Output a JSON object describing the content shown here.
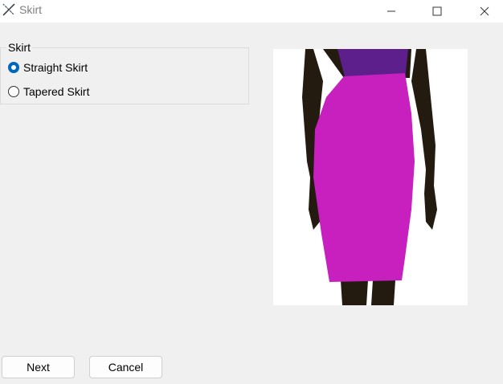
{
  "window": {
    "title": "Skirt",
    "icon": "pen-ruler-icon",
    "controls": [
      "minimize-icon",
      "maximize-icon",
      "close-icon"
    ]
  },
  "group": {
    "legend": "Skirt",
    "options": [
      {
        "label": "Straight Skirt",
        "checked": true
      },
      {
        "label": "Tapered Skirt",
        "checked": false
      }
    ]
  },
  "preview": {
    "image": "straight-skirt-illustration",
    "colors": {
      "skirt": "#c81fbf",
      "top": "#5c1f8c",
      "skin": "#231a10"
    }
  },
  "buttons": {
    "next": "Next",
    "cancel": "Cancel"
  },
  "colors": {
    "accent": "#0067c0",
    "background": "#f0f0f0"
  }
}
